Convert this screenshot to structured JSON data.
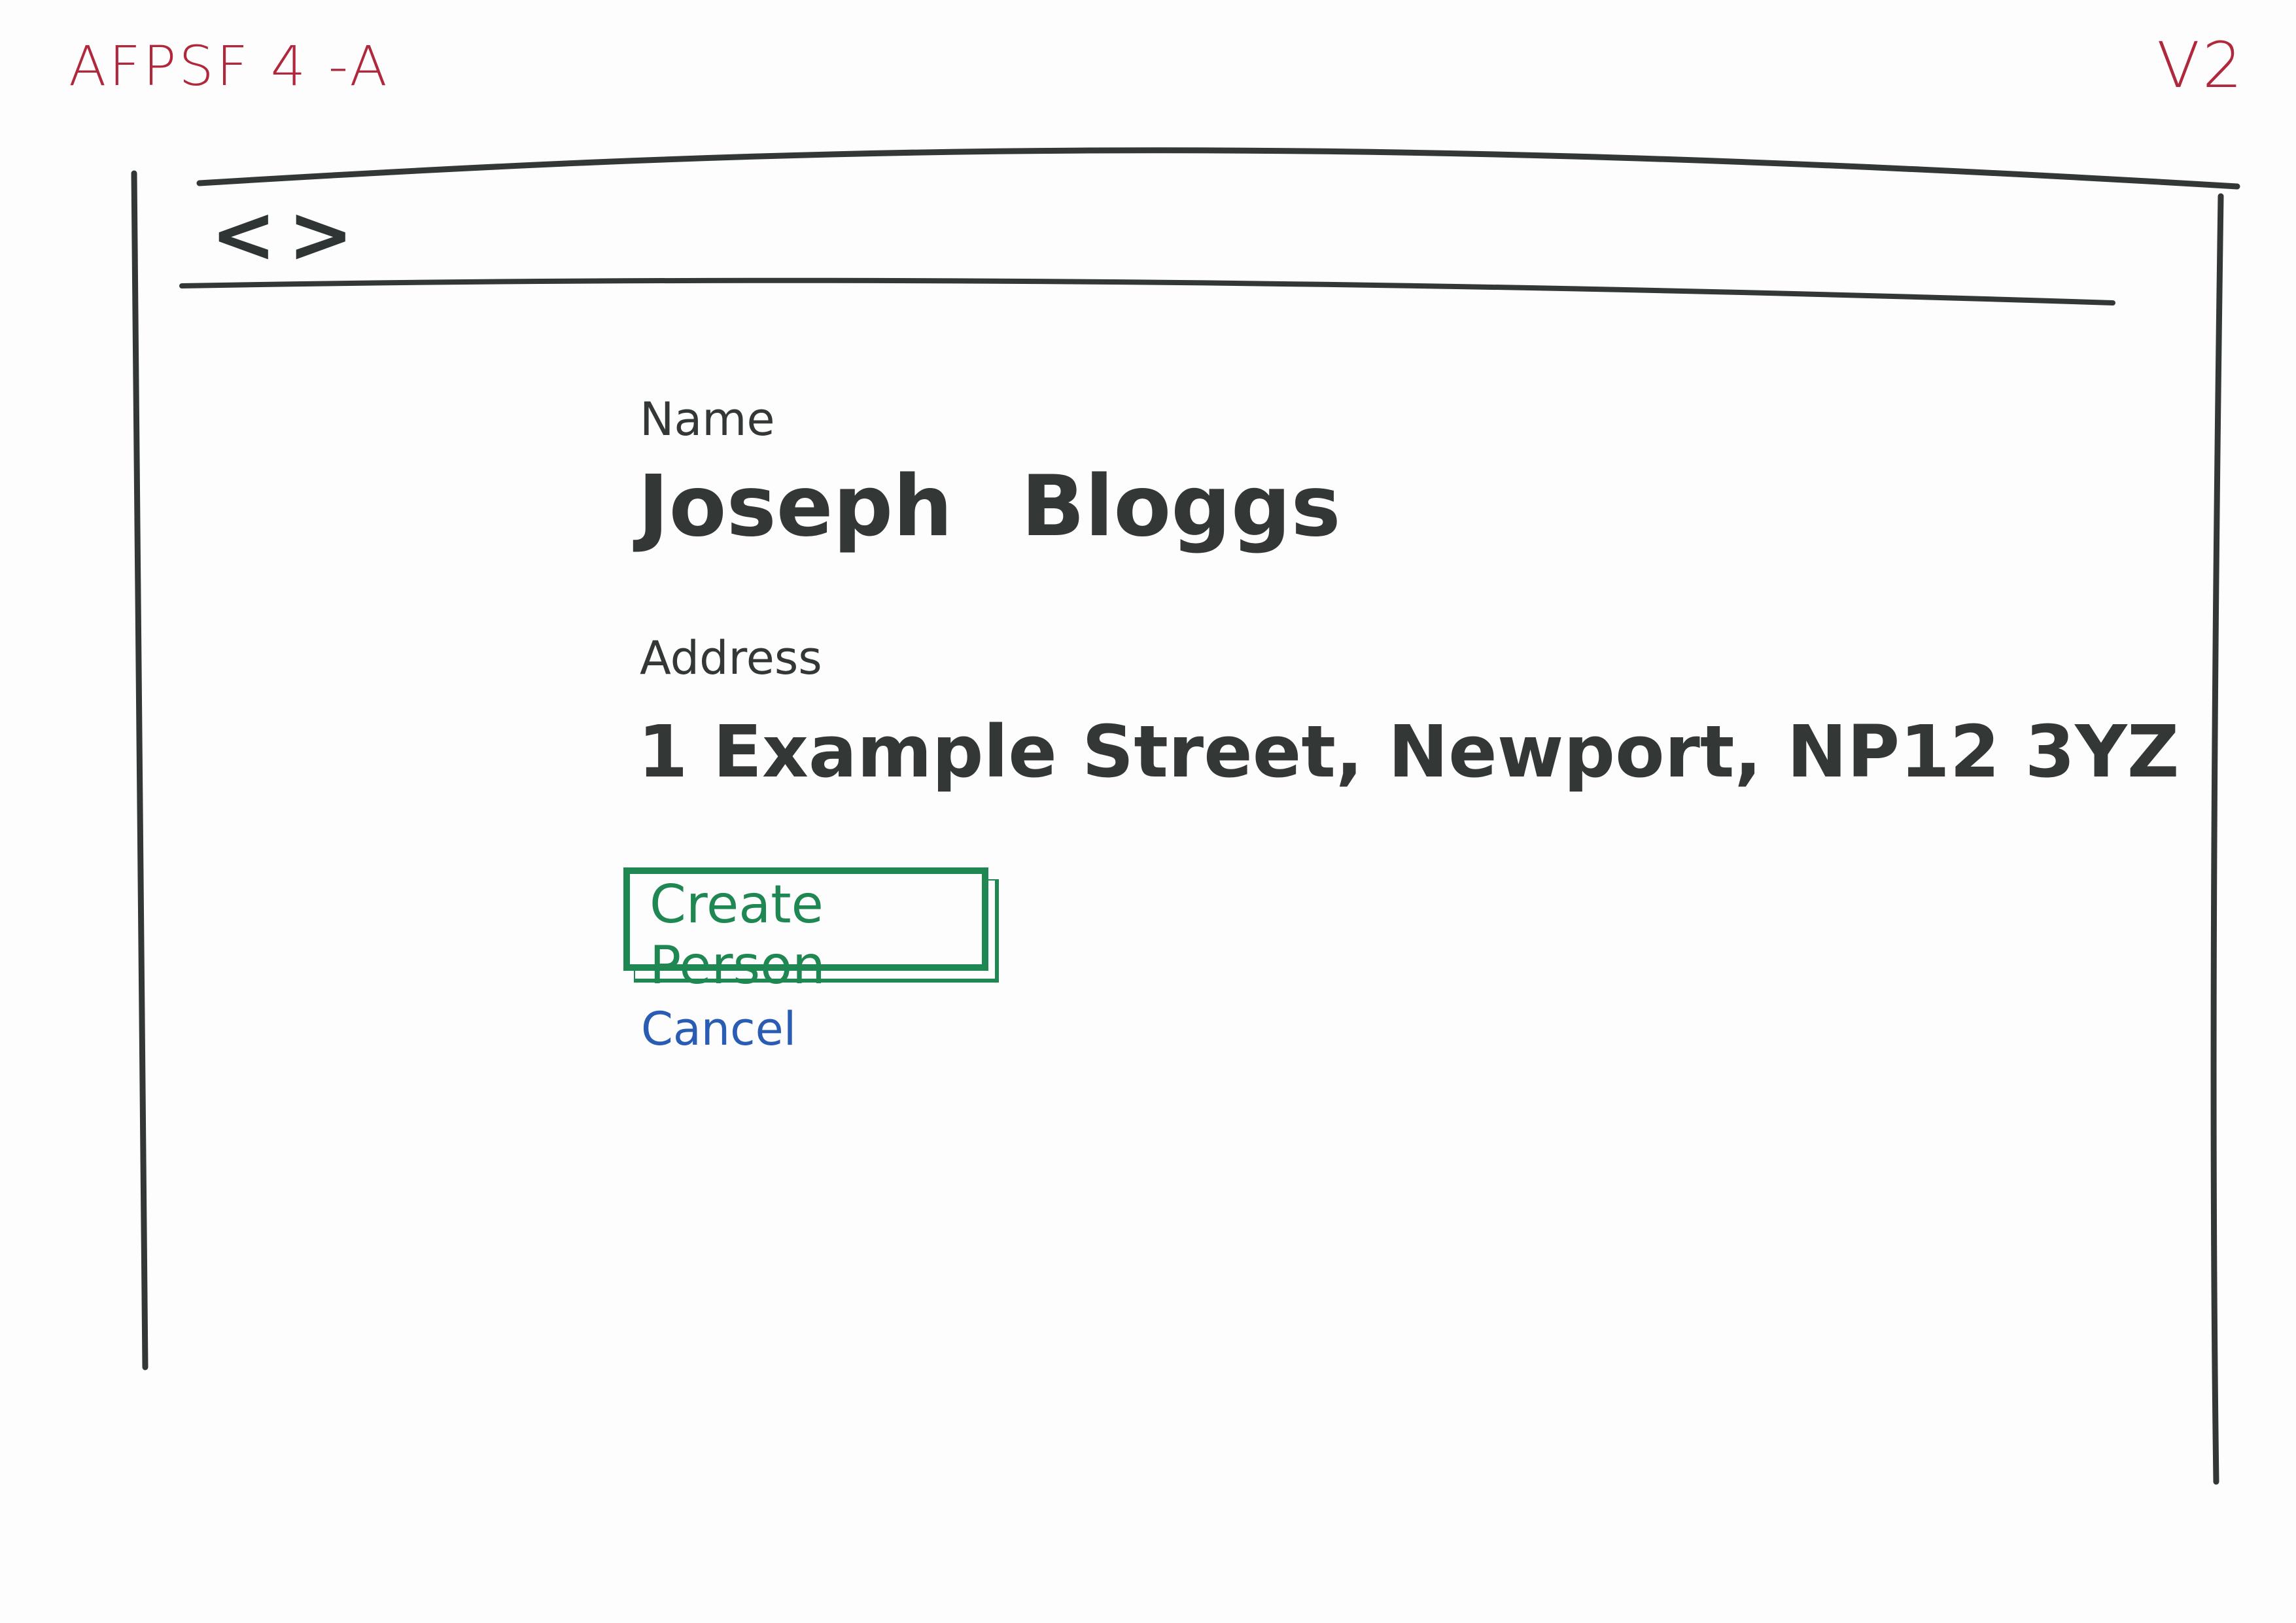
{
  "sheet": {
    "id": "AFPSF 4 -A",
    "version": "V2"
  },
  "browser": {
    "back_icon": "<",
    "forward_icon": ">"
  },
  "form": {
    "name_label": "Name",
    "name_value": "Joseph Bloggs",
    "address_label": "Address",
    "address_value": "1 Example Street, Newport, NP12 3YZ",
    "create_button_label": "Create Person",
    "cancel_label": "Cancel"
  },
  "colors": {
    "ink": "#333836",
    "annotation_red": "#b0283c",
    "button_green": "#1f8752",
    "link_blue": "#2a5cb3"
  }
}
